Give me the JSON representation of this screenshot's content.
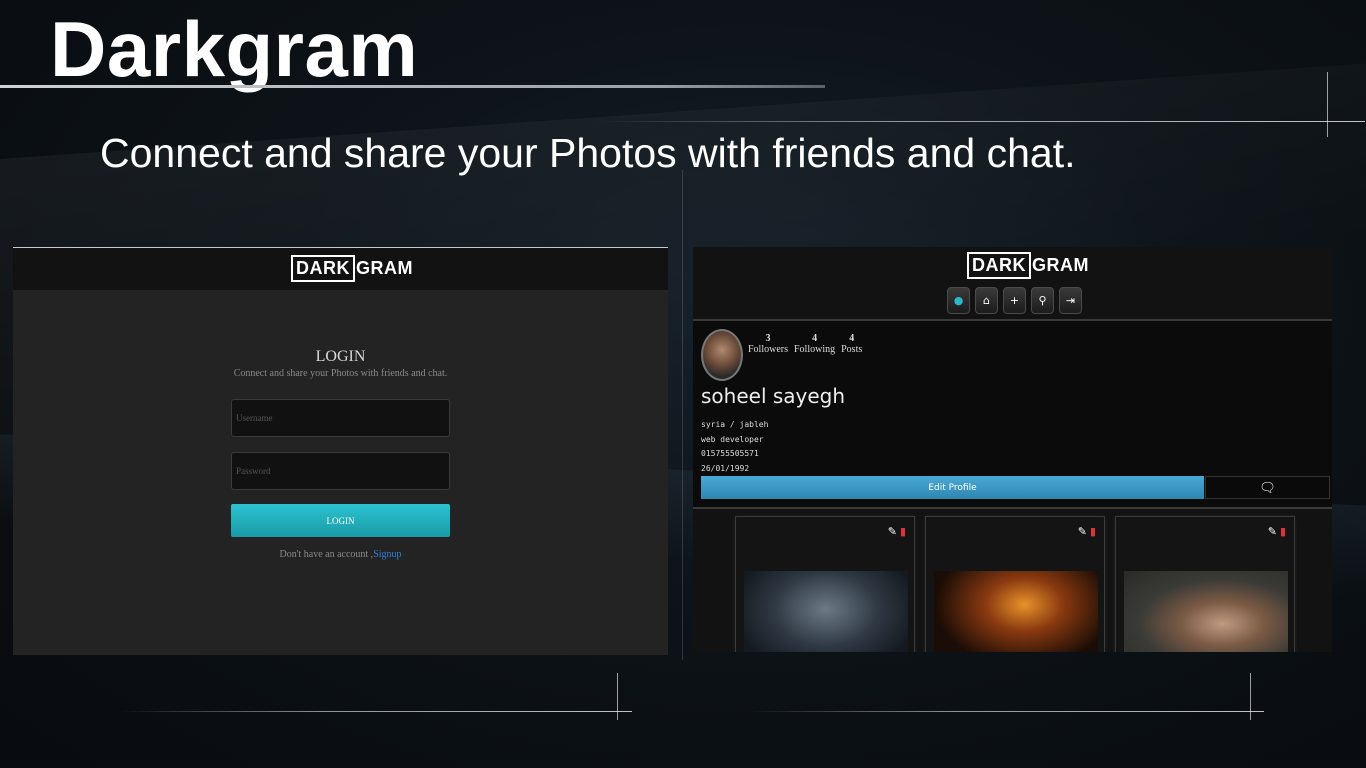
{
  "slide": {
    "title": "Darkgram",
    "subtitle": "Connect and share your Photos with friends and chat."
  },
  "login_screen": {
    "logo_box": "DARK",
    "logo_rest": "GRAM",
    "heading": "LOGIN",
    "subheading": "Connect and share your Photos with friends and chat.",
    "username_placeholder": "Username",
    "password_placeholder": "Password",
    "login_button": "LOGIN",
    "signup_prompt": "Don't have an account ,",
    "signup_link": "Signup",
    "accent_color": "#2bc3cf"
  },
  "profile_screen": {
    "logo_box": "DARK",
    "logo_rest": "GRAM",
    "nav": [
      {
        "name": "profile-icon",
        "glyph": "👤"
      },
      {
        "name": "home-icon",
        "glyph": "⌂"
      },
      {
        "name": "plus-icon",
        "glyph": "+"
      },
      {
        "name": "search-icon",
        "glyph": "⌕"
      },
      {
        "name": "logout-icon",
        "glyph": "⇥"
      }
    ],
    "stats": {
      "followers_count": "3",
      "followers_label": "Followers",
      "following_count": "4",
      "following_label": "Following",
      "posts_count": "4",
      "posts_label": "Posts"
    },
    "username": "soheel sayegh",
    "location": "syria / jableh",
    "job": "web developer",
    "phone": "015755505571",
    "birthdate": "26/01/1992",
    "edit_profile_button": "Edit Profile",
    "chat_icon": "comments-icon",
    "post_edit_icon": "edit-icon",
    "post_delete_icon": "trash-icon",
    "edit_button_color": "#3a9ccc"
  }
}
